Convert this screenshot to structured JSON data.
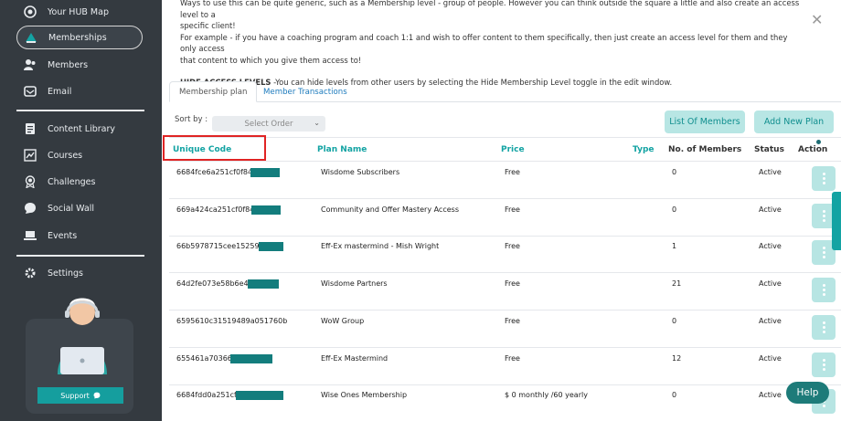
{
  "sidebar": {
    "items": [
      {
        "label": "Your HUB Map",
        "icon": "target-icon"
      },
      {
        "label": "Memberships",
        "icon": "triangle-icon"
      },
      {
        "label": "Members",
        "icon": "users-icon"
      },
      {
        "label": "Email",
        "icon": "email-icon"
      },
      {
        "label": "Content Library",
        "icon": "document-icon"
      },
      {
        "label": "Courses",
        "icon": "chart-icon"
      },
      {
        "label": "Challenges",
        "icon": "award-icon"
      },
      {
        "label": "Social Wall",
        "icon": "chat-bubble-icon"
      },
      {
        "label": "Events",
        "icon": "laptop-icon"
      },
      {
        "label": "Settings",
        "icon": "gear-icon"
      }
    ],
    "support_label": "Support"
  },
  "info": {
    "line1": "Ways to use this can be quite generic, such as a Membership level - group of people. However you can think outside the square a little and also create an access level to a",
    "line2": "specific client!",
    "line3": "For example - if you have a coaching program and coach 1:1 and wish to offer content to them specifically, then just create an access level for them and they only access",
    "line4": "that content to which you give them access to!",
    "hide_label": "HIDE ACCESS LEVELS",
    "hide_text": " -You can hide levels from other users by selecting the Hide Membership Level toggle in the edit window."
  },
  "tabs": {
    "membership_plan": "Membership plan",
    "member_transactions": "Member Transactions"
  },
  "toolbar": {
    "sort_label": "Sort by :",
    "sort_value": "Select Order",
    "list_members": "List Of Members",
    "add_plan": "Add New Plan"
  },
  "table": {
    "headers": {
      "code": "Unique Code",
      "plan": "Plan Name",
      "price": "Price",
      "type": "Type",
      "members": "No. of Members",
      "status": "Status",
      "action": "Action"
    },
    "rows": [
      {
        "code": "6684fce6a251cf0f84b",
        "plan": "Wisdome Subscribers",
        "price": "Free",
        "members": "0",
        "status": "Active"
      },
      {
        "code": "669a424ca251cf0f84b",
        "plan": "Community and Offer Mastery Access",
        "price": "Free",
        "members": "0",
        "status": "Active"
      },
      {
        "code": "66b5978715cee15259ab",
        "plan": "Eff-Ex mastermind - Mish Wright",
        "price": "Free",
        "members": "1",
        "status": "Active"
      },
      {
        "code": "64d2fe073e58b6e43",
        "plan": "Wisdome Partners",
        "price": "Free",
        "members": "21",
        "status": "Active"
      },
      {
        "code": "6595610c31519489a051760b",
        "plan": "WoW Group",
        "price": "Free",
        "members": "0",
        "status": "Active"
      },
      {
        "code": "655461a703668",
        "plan": "Eff-Ex Mastermind",
        "price": "Free",
        "members": "12",
        "status": "Active"
      },
      {
        "code": "6684fdd0a251cf0",
        "plan": "Wise Ones Membership",
        "price": "$ 0 monthly /60 yearly",
        "members": "0",
        "status": "Active"
      }
    ]
  },
  "help_label": "Help",
  "colors": {
    "sidebar_bg": "#343a40",
    "accent_teal": "#13a3a3",
    "button_bg": "#b8e6e4",
    "highlight_red": "#e02424"
  }
}
